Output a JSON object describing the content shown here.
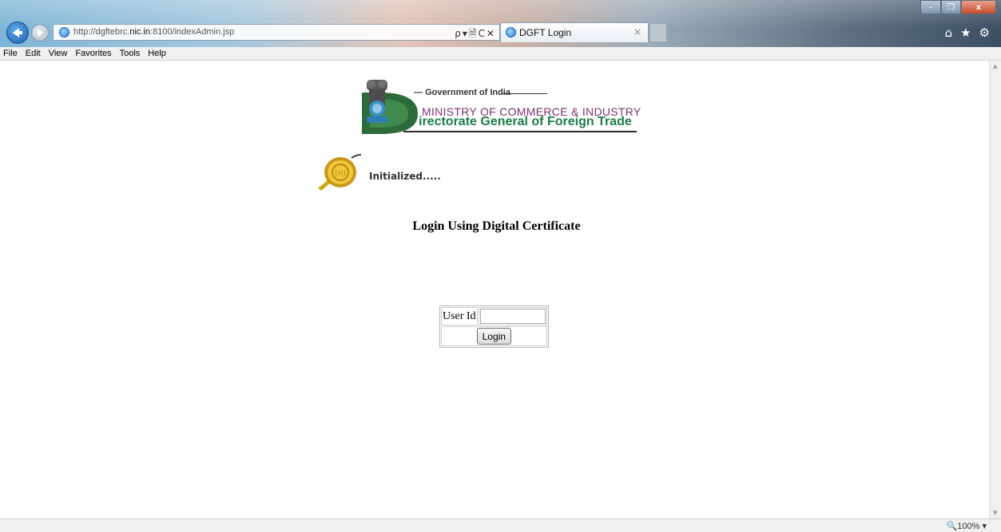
{
  "browser": {
    "url_prefix": "http://dgftebrc.",
    "url_domain": "nic.in",
    "url_suffix": ":8100/indexAdmin.jsp",
    "tab_title": "DGFT Login",
    "tab_close": "×",
    "address_tools": "ρ▾🗎C✕",
    "menu": [
      "File",
      "Edit",
      "View",
      "Favorites",
      "Tools",
      "Help"
    ],
    "window_buttons": {
      "minimize": "–",
      "maximize": "❐",
      "close": "x"
    },
    "zoom": "100%"
  },
  "header_logo": {
    "line1": "Government of India",
    "line2": "MINISTRY OF COMMERCE & INDUSTRY",
    "line3": "irectorate General of Foreign Trade"
  },
  "status_text": "Initialized.....",
  "heading": "Login Using Digital Certificate",
  "login_form": {
    "user_id_label": "User Id",
    "user_id_value": "",
    "login_button": "Login"
  },
  "colors": {
    "ministry_text": "#7d2f73",
    "directorate_text": "#1b7d46"
  }
}
